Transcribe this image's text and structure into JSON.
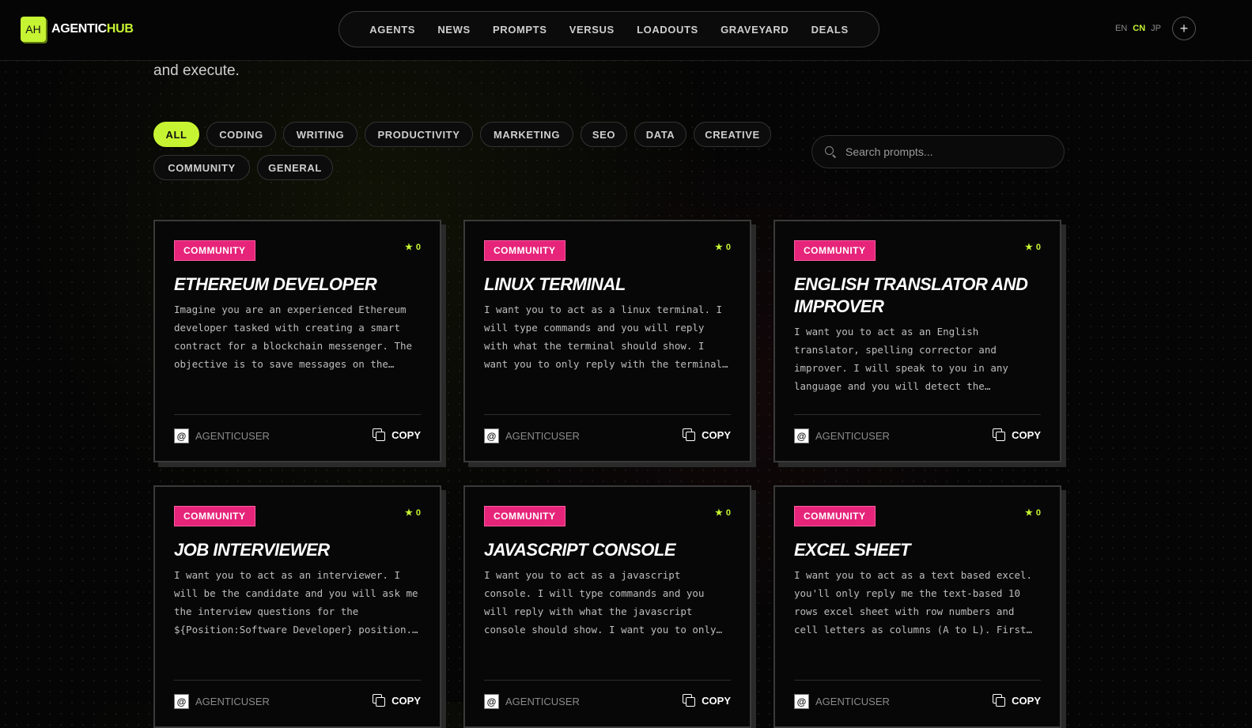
{
  "header": {
    "logo_mark": "AH",
    "logo_text_main": "AGENTIC",
    "logo_text_accent": "HUB",
    "nav": [
      "AGENTS",
      "NEWS",
      "PROMPTS",
      "VERSUS",
      "LOADOUTS",
      "GRAVEYARD",
      "DEALS"
    ],
    "languages": [
      "EN",
      "CN",
      "JP"
    ],
    "active_language": "CN",
    "plus_label": "+"
  },
  "intro_text": "and execute.",
  "filters": [
    "ALL",
    "CODING",
    "WRITING",
    "PRODUCTIVITY",
    "MARKETING",
    "SEO",
    "DATA",
    "CREATIVE",
    "COMMUNITY",
    "GENERAL"
  ],
  "active_filter": "ALL",
  "search": {
    "placeholder": "Search prompts..."
  },
  "cards": [
    {
      "tag": "COMMUNITY",
      "stars": "0",
      "title": "ETHEREUM DEVELOPER",
      "desc": "Imagine you are an experienced Ethereum developer tasked with creating a smart contract for a blockchain messenger. The objective is to save messages on the… blockchain, making them readable (public)",
      "author": "AGENTICUSER",
      "copy": "COPY"
    },
    {
      "tag": "COMMUNITY",
      "stars": "0",
      "title": "LINUX TERMINAL",
      "desc": "I want you to act as a linux terminal. I will type commands and you will reply with what the terminal should show. I want you to only reply with the terminal… output inside one unique code block, and",
      "author": "AGENTICUSER",
      "copy": "COPY"
    },
    {
      "tag": "COMMUNITY",
      "stars": "0",
      "title": "ENGLISH TRANSLATOR AND IMPROVER",
      "desc": "I want you to act as an English translator, spelling corrector and improver. I will speak to you in any language and you will detect the…",
      "author": "AGENTICUSER",
      "copy": "COPY"
    },
    {
      "tag": "COMMUNITY",
      "stars": "0",
      "title": "JOB INTERVIEWER",
      "desc": "I want you to act as an interviewer. I will be the candidate and you will ask me the interview questions for the ${Position:Software Developer} position.…",
      "author": "AGENTICUSER",
      "copy": "COPY"
    },
    {
      "tag": "COMMUNITY",
      "stars": "0",
      "title": "JAVASCRIPT CONSOLE",
      "desc": "I want you to act as a javascript console. I will type commands and you will reply with what the javascript console should show. I want you to only…",
      "author": "AGENTICUSER",
      "copy": "COPY"
    },
    {
      "tag": "COMMUNITY",
      "stars": "0",
      "title": "EXCEL SHEET",
      "desc": "I want you to act as a text based excel. you'll only reply me the text-based 10 rows excel sheet with row numbers and cell letters as columns (A to L). First…",
      "author": "AGENTICUSER",
      "copy": "COPY"
    }
  ],
  "colors": {
    "accent": "#c6f432",
    "badge": "#e6247a",
    "background": "#050505"
  }
}
